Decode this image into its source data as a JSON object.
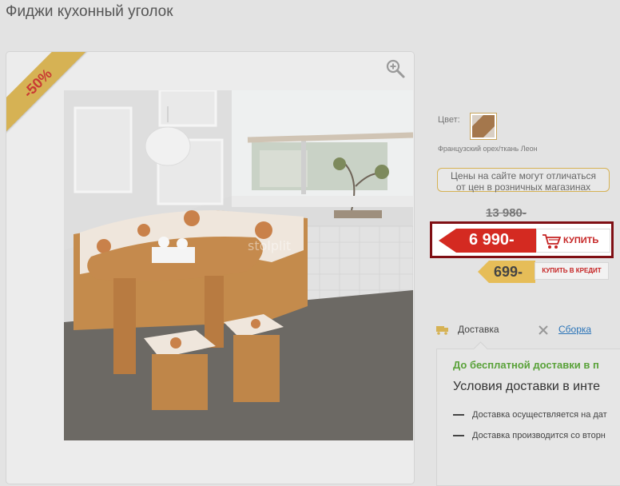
{
  "page": {
    "title": "Фиджи кухонный уголок"
  },
  "photo": {
    "discount_badge": "-50%",
    "watermark": "stolplit"
  },
  "options": {
    "color_label": "Цвет:",
    "swatch_name": "Французский орех/ткань Леон"
  },
  "notice": {
    "line1": "Цены на сайте могут отличаться",
    "line2": "от цен в розничных магазинах"
  },
  "price": {
    "old": "13 980-",
    "current": "6 990-",
    "buy_label": "КУПИТЬ",
    "credit_amount": "699-",
    "credit_label": "КУПИТЬ В КРЕДИТ"
  },
  "tabs": [
    {
      "label": "Доставка"
    },
    {
      "label": "Сборка"
    }
  ],
  "delivery": {
    "free_text": "До бесплатной доставки в п",
    "heading": "Условия доставки в инте",
    "items": [
      "Доставка осуществляется на дат",
      "Доставка производится со вторн"
    ]
  },
  "colors": {
    "accent": "#d6b254",
    "price_red": "#c52222",
    "frame": "#7f0f14",
    "link": "#2b74b8",
    "green": "#5aa23a"
  }
}
